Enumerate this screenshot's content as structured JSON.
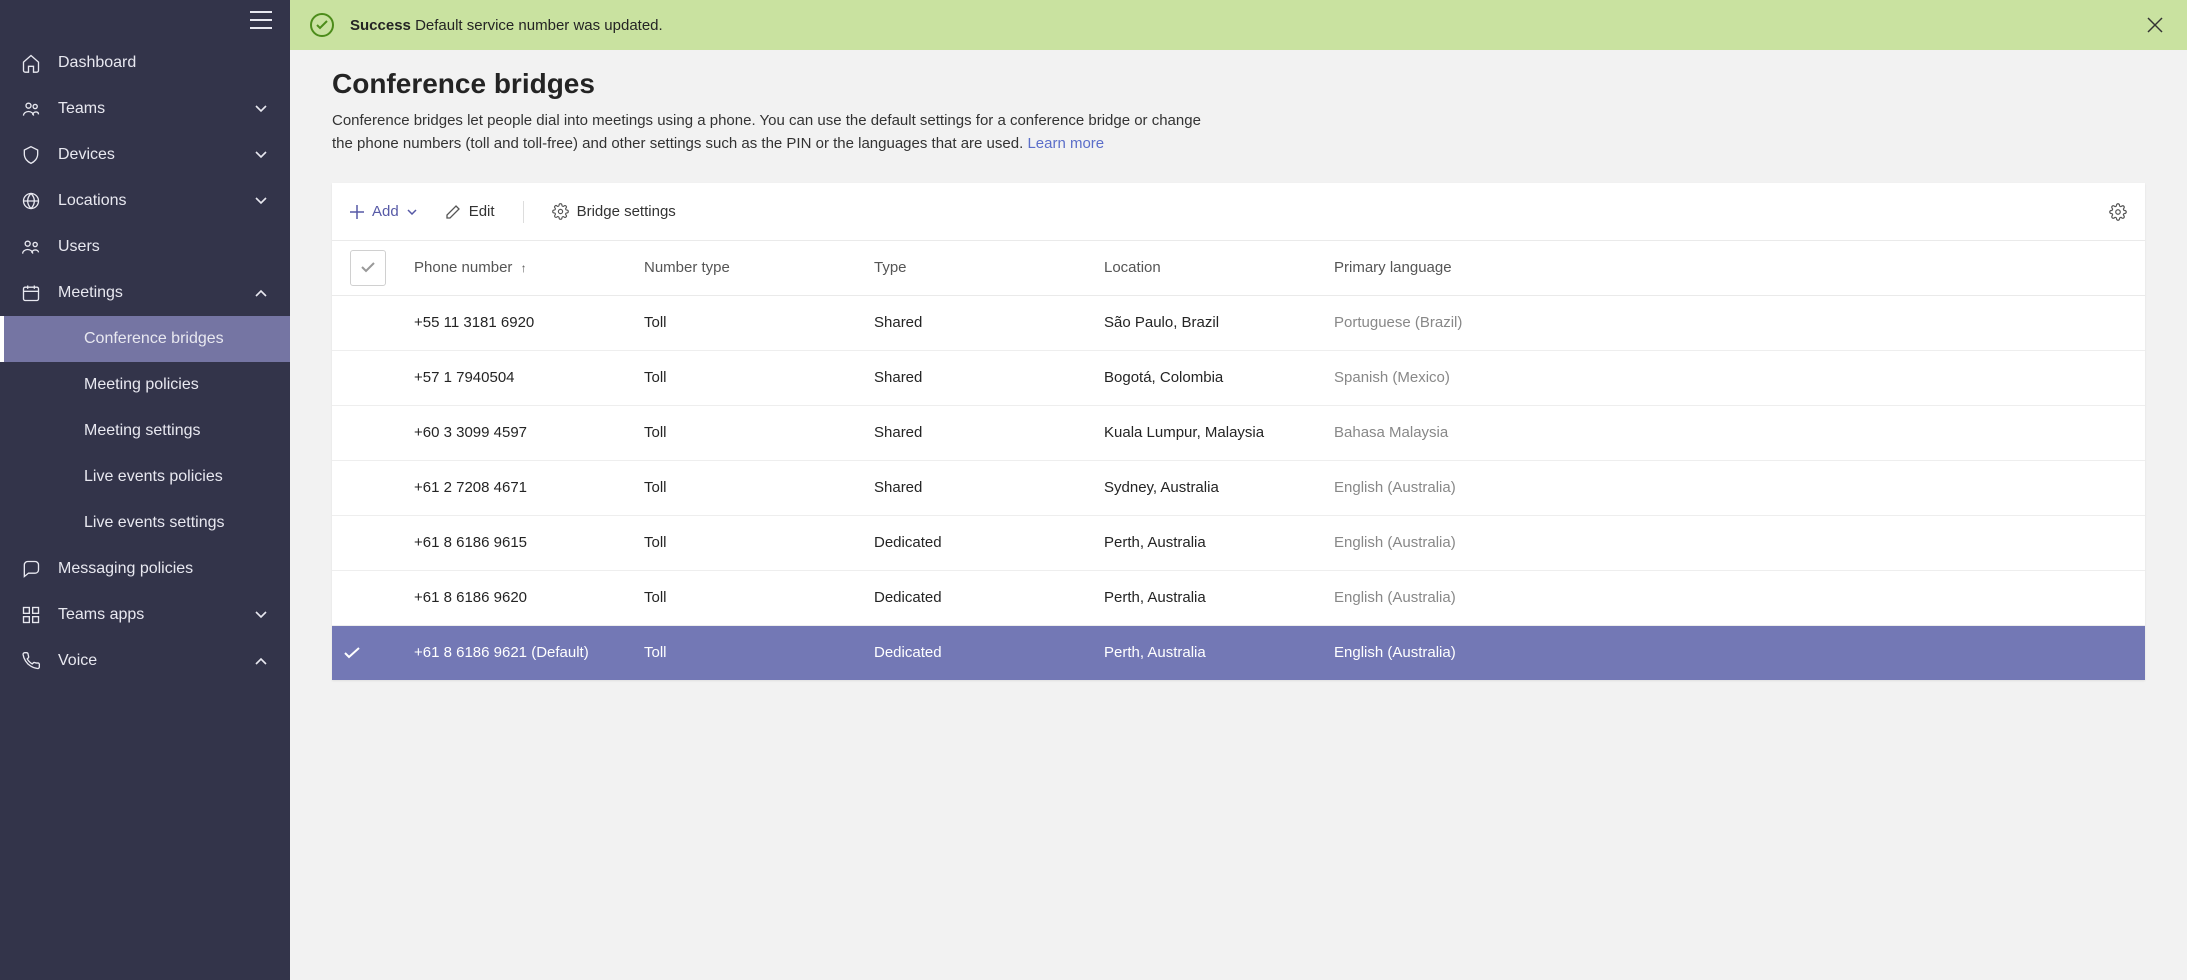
{
  "banner": {
    "strong": "Success",
    "message": "Default service number was updated."
  },
  "page": {
    "title": "Conference bridges",
    "description": "Conference bridges let people dial into meetings using a phone. You can use the default settings for a conference bridge or change the phone numbers (toll and toll-free) and other settings such as the PIN or the languages that are used.",
    "learn_more": "Learn more"
  },
  "toolbar": {
    "add": "Add",
    "edit": "Edit",
    "bridge_settings": "Bridge settings"
  },
  "columns": {
    "phone": "Phone number",
    "ntype": "Number type",
    "type": "Type",
    "location": "Location",
    "language": "Primary language"
  },
  "rows": [
    {
      "phone": "+55 11 3181 6920",
      "ntype": "Toll",
      "type": "Shared",
      "location": "São Paulo, Brazil",
      "language": "Portuguese (Brazil)",
      "selected": false
    },
    {
      "phone": "+57 1 7940504",
      "ntype": "Toll",
      "type": "Shared",
      "location": "Bogotá, Colombia",
      "language": "Spanish (Mexico)",
      "selected": false
    },
    {
      "phone": "+60 3 3099 4597",
      "ntype": "Toll",
      "type": "Shared",
      "location": "Kuala Lumpur, Malaysia",
      "language": "Bahasa Malaysia",
      "selected": false
    },
    {
      "phone": "+61 2 7208 4671",
      "ntype": "Toll",
      "type": "Shared",
      "location": "Sydney, Australia",
      "language": "English (Australia)",
      "selected": false
    },
    {
      "phone": "+61 8 6186 9615",
      "ntype": "Toll",
      "type": "Dedicated",
      "location": "Perth, Australia",
      "language": "English (Australia)",
      "selected": false
    },
    {
      "phone": "+61 8 6186 9620",
      "ntype": "Toll",
      "type": "Dedicated",
      "location": "Perth, Australia",
      "language": "English (Australia)",
      "selected": false
    },
    {
      "phone": "+61 8 6186 9621 (Default)",
      "ntype": "Toll",
      "type": "Dedicated",
      "location": "Perth, Australia",
      "language": "English (Australia)",
      "selected": true
    }
  ],
  "sidebar": {
    "items": [
      {
        "label": "Dashboard",
        "icon": "home",
        "expandable": false
      },
      {
        "label": "Teams",
        "icon": "teams",
        "expandable": true,
        "expanded": false
      },
      {
        "label": "Devices",
        "icon": "devices",
        "expandable": true,
        "expanded": false
      },
      {
        "label": "Locations",
        "icon": "globe",
        "expandable": true,
        "expanded": false
      },
      {
        "label": "Users",
        "icon": "users",
        "expandable": false
      },
      {
        "label": "Meetings",
        "icon": "calendar",
        "expandable": true,
        "expanded": true,
        "children": [
          {
            "label": "Conference bridges",
            "active": true
          },
          {
            "label": "Meeting policies",
            "active": false
          },
          {
            "label": "Meeting settings",
            "active": false
          },
          {
            "label": "Live events policies",
            "active": false
          },
          {
            "label": "Live events settings",
            "active": false
          }
        ]
      },
      {
        "label": "Messaging policies",
        "icon": "chat",
        "expandable": false
      },
      {
        "label": "Teams apps",
        "icon": "apps",
        "expandable": true,
        "expanded": false
      },
      {
        "label": "Voice",
        "icon": "phone",
        "expandable": true,
        "expanded": true
      }
    ]
  }
}
